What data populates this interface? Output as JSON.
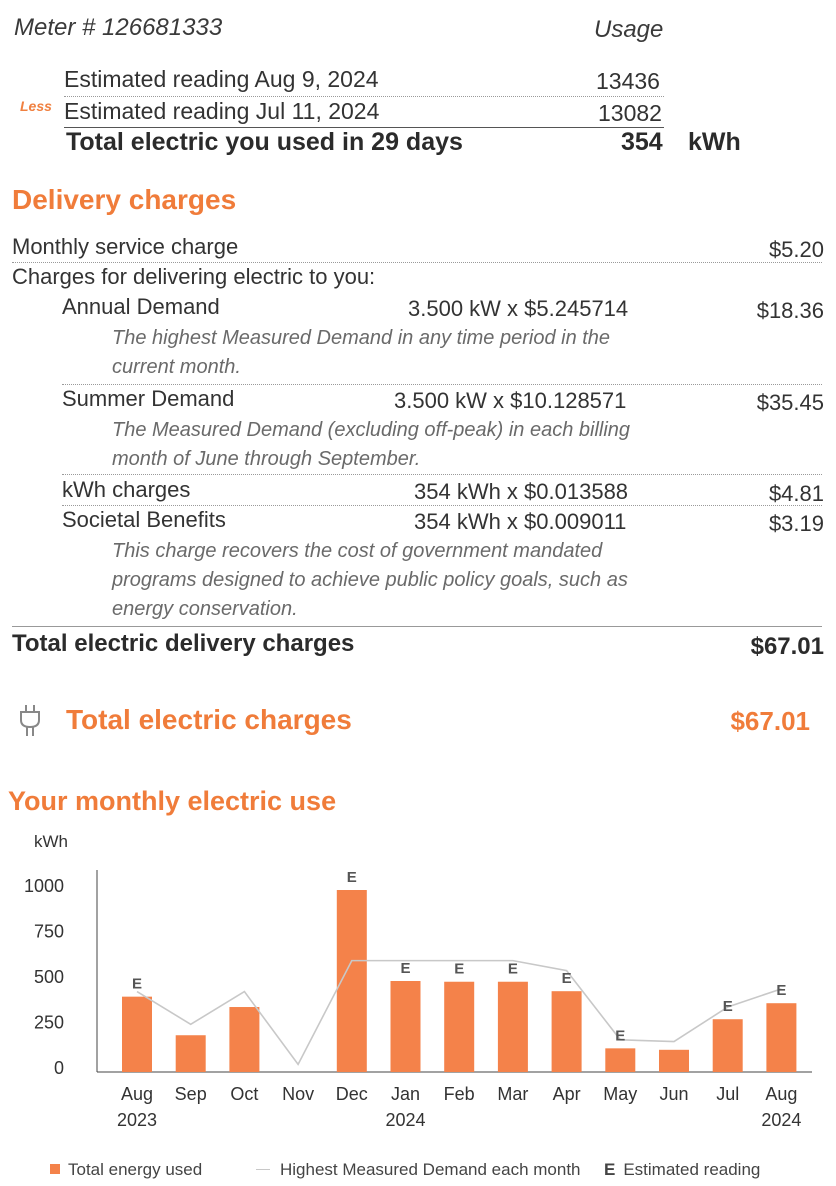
{
  "meter": {
    "label": "Meter # 126681333",
    "usage_header": "Usage",
    "readings": [
      {
        "prefix": "",
        "label": "Estimated reading Aug 9, 2024",
        "value": "13436"
      },
      {
        "prefix": "Less",
        "label": "Estimated reading Jul 11, 2024",
        "value": "13082"
      }
    ],
    "total_label": "Total electric you used in 29 days",
    "total_value": "354",
    "total_unit": "kWh"
  },
  "delivery": {
    "title": "Delivery charges",
    "monthly_service": {
      "label": "Monthly service charge",
      "amount": "$5.20"
    },
    "delivering_label": "Charges for delivering electric to you:",
    "items": [
      {
        "label": "Annual Demand",
        "calc": "3.500 kW x $5.245714",
        "amount": "$18.36",
        "desc": "The highest Measured Demand in any time period in the current month."
      },
      {
        "label": "Summer Demand",
        "calc": "3.500 kW x $10.128571",
        "amount": "$35.45",
        "desc": "The Measured Demand (excluding off-peak) in each billing month of June through September."
      },
      {
        "label": "kWh charges",
        "calc": "354 kWh x $0.013588",
        "amount": "$4.81",
        "desc": ""
      },
      {
        "label": "Societal Benefits",
        "calc": "354 kWh x $0.009011",
        "amount": "$3.19",
        "desc": "This charge recovers the cost of government mandated programs designed to achieve public policy goals, such as energy conservation."
      }
    ],
    "total_label": "Total electric delivery charges",
    "total_amount": "$67.01"
  },
  "total_electric": {
    "label": "Total electric charges",
    "amount": "$67.01",
    "icon": "plug-icon"
  },
  "chart_section_title": "Your monthly electric use",
  "chart_data": {
    "type": "bar",
    "ylabel": "kWh",
    "ylim": [
      0,
      1000
    ],
    "yticks": [
      0,
      250,
      500,
      750,
      1000
    ],
    "categories": [
      "Aug 2023",
      "Sep",
      "Oct",
      "Nov",
      "Dec",
      "Jan 2024",
      "Feb",
      "Mar",
      "Apr",
      "May",
      "Jun",
      "Jul",
      "Aug 2024"
    ],
    "category_labels": [
      [
        "Aug",
        "2023"
      ],
      [
        "Sep",
        ""
      ],
      [
        "Oct",
        ""
      ],
      [
        "Nov",
        ""
      ],
      [
        "Dec",
        ""
      ],
      [
        "Jan",
        "2024"
      ],
      [
        "Feb",
        ""
      ],
      [
        "Mar",
        ""
      ],
      [
        "Apr",
        ""
      ],
      [
        "May",
        ""
      ],
      [
        "Jun",
        ""
      ],
      [
        "Jul",
        ""
      ],
      [
        "Aug",
        "2024"
      ]
    ],
    "series": [
      {
        "name": "Total energy used",
        "type": "bar",
        "color": "#f4824a",
        "values": [
          392,
          180,
          335,
          0,
          978,
          478,
          474,
          474,
          422,
          108,
          100,
          268,
          356
        ]
      },
      {
        "name": "Highest Measured Demand each month",
        "type": "line",
        "color": "#c8c8c8",
        "values": [
          420,
          240,
          420,
          20,
          590,
          590,
          590,
          590,
          535,
          155,
          145,
          335,
          435
        ]
      }
    ],
    "estimated": [
      true,
      false,
      false,
      false,
      true,
      true,
      true,
      true,
      true,
      true,
      false,
      true,
      true
    ],
    "estimated_marker": "E",
    "legend": {
      "bar": "Total energy used",
      "line": "Highest Measured Demand each month",
      "estimated_symbol": "E",
      "estimated": "Estimated reading"
    }
  }
}
